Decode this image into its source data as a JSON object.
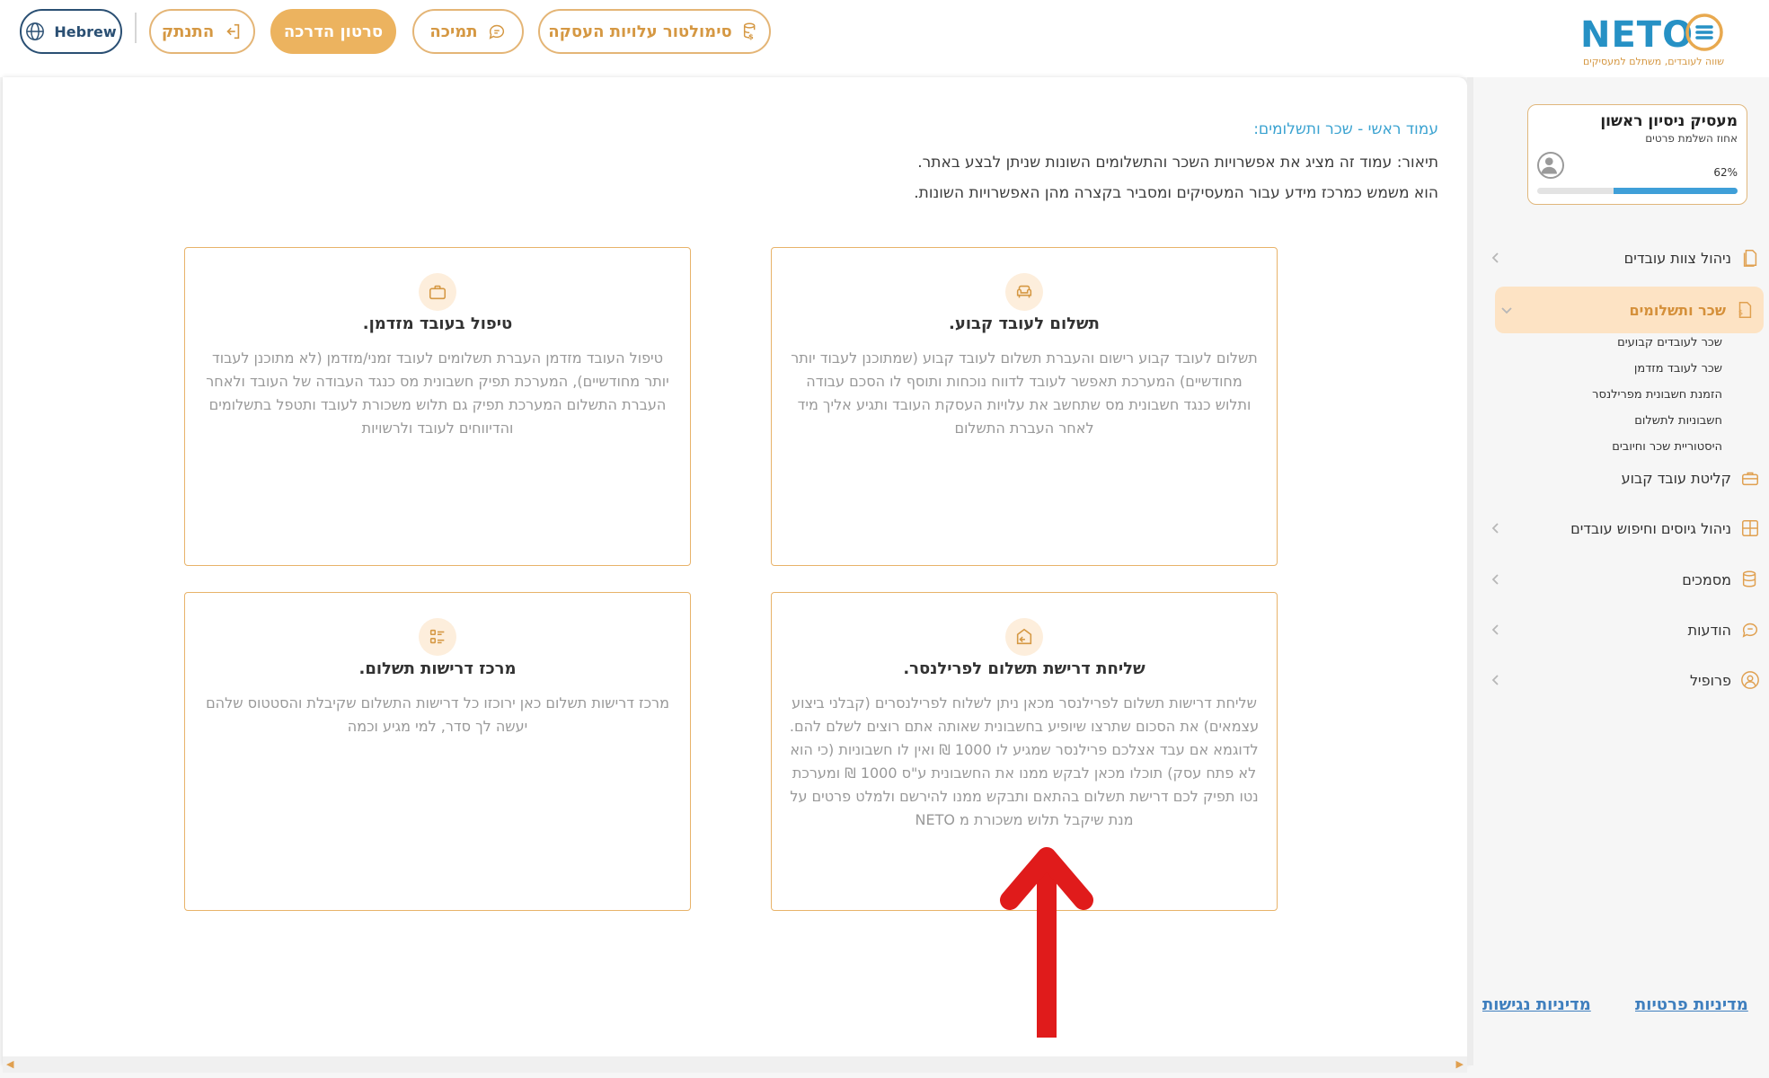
{
  "topbar": {
    "lang_label": "Hebrew",
    "logout_label": "התנתק",
    "tutorial_label": "סרטון הדרכה",
    "support_label": "תמיכה",
    "simulator_label": "סימולטור עלויות העסקה"
  },
  "logo": {
    "word": "NETO",
    "tagline": "שווה לעובדים, משתלם למעסיקים"
  },
  "page": {
    "breadcrumb": "עמוד ראשי - שכר ותשלומים:",
    "desc_line1": "תיאור: עמוד זה מציג את אפשרויות השכר והתשלומים השונות שניתן לבצע באתר.",
    "desc_line2": "הוא משמש כמרכז מידע עבור המעסיקים ומסביר בקצרה מהן האפשרויות השונות."
  },
  "cards": [
    {
      "icon": "sofa-icon",
      "title": "תשלום לעובד קבוע.",
      "body": "תשלום לעובד קבוע רישום והעברת תשלום לעובד קבוע (שמתוכנן לעבוד יותר מחודשיים) המערכת תאפשר לעובד לדווח נוכחות ותוסף לו הסכם עבודה ותלוש כנגד חשבונית מס שתחשב את עלויות העסקת העובד ותגיע אליך מיד לאחר העברת התשלום"
    },
    {
      "icon": "briefcase-icon",
      "title": "טיפול בעובד מזדמן.",
      "body": "טיפול העובד מזדמן העברת תשלומים לעובד זמני/מזדמן (לא מתוכנן לעבוד יותר מחודשיים), המערכת תפיק חשבונית מס כנגד העבודה של העובד ולאחר העברת התשלום המערכת תפיק גם תלוש משכורת לעובד ותטפל בתשלומים והדיווחים לעובד ולרשויות"
    },
    {
      "icon": "exit-icon",
      "title": "שליחת דרישת תשלום לפרילנסר.",
      "body": "שליחת דרישות תשלום לפרילנסר מכאן ניתן לשלוח לפרילנסרים (קבלני ביצוע עצמאים) את הסכום שתרצו שיופיע בחשבונית שאותה אתם רוצים לשלם להם. לדוגמא אם עבד אצלכם פרילנסר שמגיע לו 1000 ₪ ואין לו חשבוניות (כי הוא לא פתח עסק) תוכלו מכאן לבקש ממנו את החשבונית ע\"ס 1000 ₪ ומערכת נטו תפיק לכם דרישת תשלום בהתאם ותבקש ממנו להירשם ולמלט פרטים על מנת שיקבל תלוש משכורת מ NETO"
    },
    {
      "icon": "list-icon",
      "title": "מרכז דרישות תשלום.",
      "body": "מרכז דרישות תשלום כאן ירוכזו כל דרישות התשלום שקיבלת והסטטוס שלהם יעשה לך סדר, למי מגיע וכמה"
    }
  ],
  "sidebar": {
    "profile_name": "מעסיק ניסיון ראשון",
    "profile_sub": "אחוז השלמת פרטים",
    "profile_pct_label": "62%",
    "profile_pct": 62,
    "nav": [
      {
        "label": "ניהול צוות עובדים",
        "icon": "document-icon"
      },
      {
        "label": "שכר ותשלומים",
        "icon": "payroll-icon"
      },
      {
        "label": "קליטת עובד קבוע",
        "icon": "briefcase-icon"
      },
      {
        "label": "ניהול גיוסים וחיפוש עובדים",
        "icon": "grid-add-icon"
      },
      {
        "label": "מסמכים",
        "icon": "files-icon"
      },
      {
        "label": "הודעות",
        "icon": "chat-icon"
      },
      {
        "label": "פרופיל",
        "icon": "user-circle-icon"
      }
    ],
    "sub": [
      "שכר לעובדים קבועים",
      "שכר לעובד מזדמן",
      "הזמנת חשבונית מפרילנסר",
      "חשבוניות לתשלום",
      "היסטוריית שכר וחיובים"
    ],
    "privacy_label": "מדיניות פרטיות",
    "access_label": "מדיניות נגישות"
  },
  "colors": {
    "accent": "#ecb35f",
    "accent_text": "#d59843",
    "brand_blue": "#2691c5",
    "link_blue": "#3f7fbe",
    "arrow": "#e01b1b"
  }
}
